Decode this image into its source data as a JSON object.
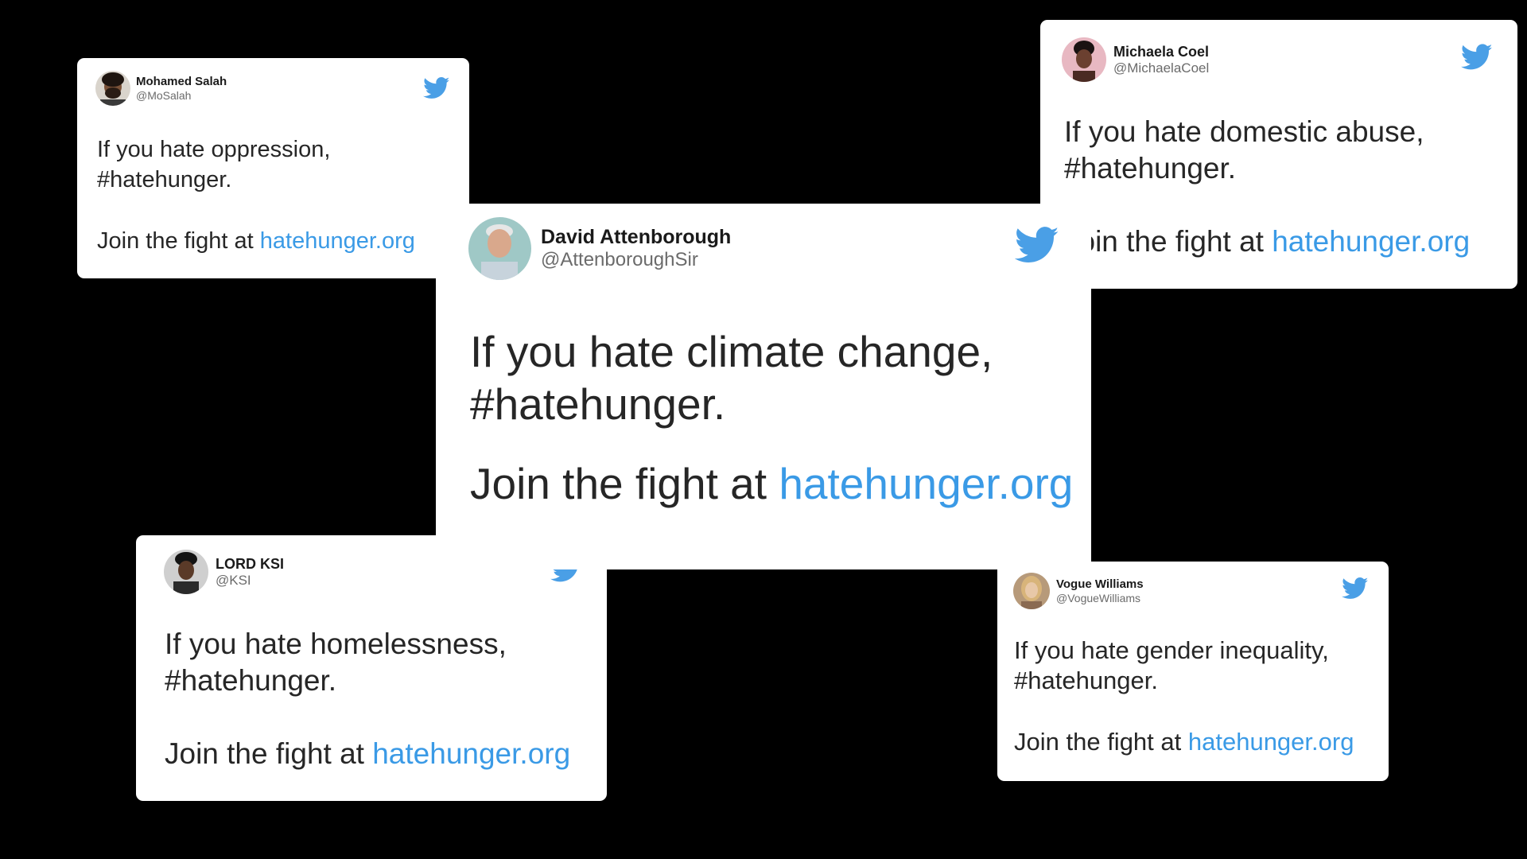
{
  "tweets": [
    {
      "display_name": "Mohamed Salah",
      "handle": "@MoSalah",
      "line1": "If you hate oppression,",
      "line2": "#hatehunger.",
      "join_prefix": "Join the fight at ",
      "link": "hatehunger.org",
      "avatar_icon": "profile-photo"
    },
    {
      "display_name": "Michaela Coel",
      "handle": "@MichaelaCoel",
      "line1": "If you hate domestic abuse,",
      "line2": "#hatehunger.",
      "join_prefix": "Join the fight at ",
      "link": "hatehunger.org",
      "avatar_icon": "profile-photo"
    },
    {
      "display_name": "David Attenborough",
      "handle": "@AttenboroughSir",
      "line1": "If you hate climate change,",
      "line2": "#hatehunger.",
      "join_prefix": "Join the fight at ",
      "link": "hatehunger.org",
      "avatar_icon": "profile-photo"
    },
    {
      "display_name": "LORD KSI",
      "handle": "@KSI",
      "line1": "If you hate homelessness,",
      "line2": "#hatehunger.",
      "join_prefix": "Join the fight at ",
      "link": "hatehunger.org",
      "avatar_icon": "profile-photo"
    },
    {
      "display_name": "Vogue Williams",
      "handle": "@VogueWilliams",
      "line1": "If you hate gender inequality,",
      "line2": "#hatehunger.",
      "join_prefix": "Join the fight at ",
      "link": "hatehunger.org",
      "avatar_icon": "profile-photo"
    }
  ],
  "colors": {
    "background": "#000000",
    "card": "#ffffff",
    "link": "#3a9ae6",
    "twitter_blue": "#4a9fe6",
    "handle_gray": "#6b6b6b"
  },
  "icons": {
    "brand": "twitter-bird-icon"
  }
}
